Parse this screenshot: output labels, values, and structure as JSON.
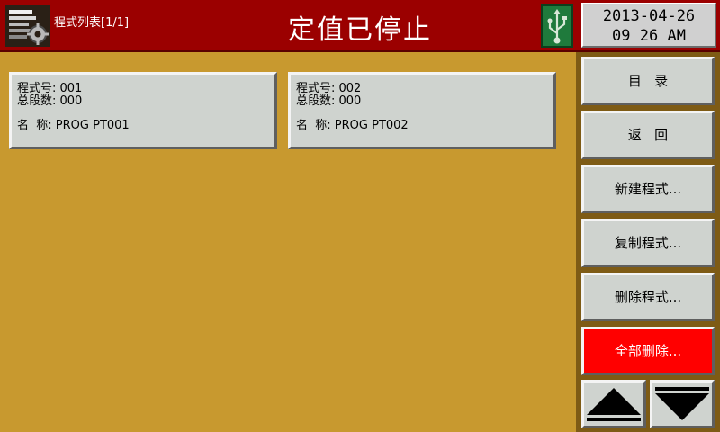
{
  "header": {
    "subtitle": "程式列表[1/1]",
    "title": "定值已停止",
    "date": "2013-04-26",
    "time": "09 26 AM",
    "app_icon": "program-list-icon",
    "usb_icon": "usb-icon"
  },
  "programs": [
    {
      "number_label": "程式号: 001",
      "segments_label": "总段数: 000",
      "name_prefix": "名  称:",
      "name_value": "PROG PT001"
    },
    {
      "number_label": "程式号: 002",
      "segments_label": "总段数: 000",
      "name_prefix": "名  称:",
      "name_value": "PROG PT002"
    }
  ],
  "side_buttons": {
    "menu": "目   录",
    "back": "返   回",
    "new": "新建程式...",
    "copy": "复制程式...",
    "delete": "删除程式...",
    "delete_all": "全部删除..."
  },
  "nav": {
    "up_icon": "triangle-up-icon",
    "down_icon": "triangle-down-icon"
  },
  "colors": {
    "background": "#c8992f",
    "header": "#9b0000",
    "button": "#cfd3cf",
    "danger": "#ff0000",
    "usb": "#1f7a3c"
  }
}
